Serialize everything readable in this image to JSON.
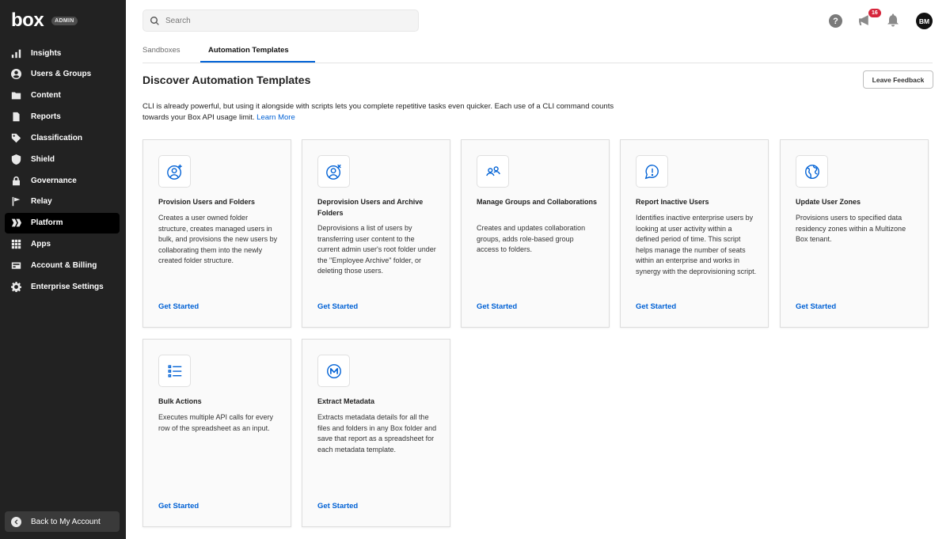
{
  "brand": {
    "logo": "box",
    "badge": "ADMIN"
  },
  "sidebar": {
    "items": [
      {
        "label": "Insights",
        "icon": "bar-chart-icon"
      },
      {
        "label": "Users & Groups",
        "icon": "user-circle-icon"
      },
      {
        "label": "Content",
        "icon": "folder-icon"
      },
      {
        "label": "Reports",
        "icon": "report-icon"
      },
      {
        "label": "Classification",
        "icon": "tag-icon"
      },
      {
        "label": "Shield",
        "icon": "shield-icon"
      },
      {
        "label": "Governance",
        "icon": "lock-icon"
      },
      {
        "label": "Relay",
        "icon": "relay-icon"
      },
      {
        "label": "Platform",
        "icon": "platform-icon"
      },
      {
        "label": "Apps",
        "icon": "apps-grid-icon"
      },
      {
        "label": "Account & Billing",
        "icon": "billing-icon"
      },
      {
        "label": "Enterprise Settings",
        "icon": "gear-icon"
      }
    ],
    "active": "Platform",
    "back_label": "Back to My Account"
  },
  "header": {
    "search_placeholder": "Search",
    "help": "?",
    "notification_count": "16",
    "avatar_initials": "BM"
  },
  "tabs": [
    {
      "label": "Sandboxes"
    },
    {
      "label": "Automation Templates"
    }
  ],
  "active_tab": "Automation Templates",
  "page": {
    "title": "Discover Automation Templates",
    "feedback_button": "Leave Feedback",
    "intro": "CLI is already powerful, but using it alongside with scripts lets you complete repetitive tasks even quicker. Each use of a CLI command counts towards your Box API usage limit.",
    "learn_more": "Learn More"
  },
  "accent_color": "#0061d5",
  "cards": [
    {
      "icon": "user-add-icon",
      "title": "Provision Users and Folders",
      "description": "Creates a user owned folder structure, creates managed users in bulk, and provisions the new users by collaborating them into the newly created folder structure.",
      "link": "Get Started"
    },
    {
      "icon": "user-remove-icon",
      "title": "Deprovision Users and Archive Folders",
      "description": "Deprovisions a list of users by transferring user content to the current admin user's root folder under the \"Employee Archive\" folder, or deleting those users.",
      "link": "Get Started"
    },
    {
      "icon": "group-icon",
      "title": "Manage Groups and Collaborations",
      "description": "Creates and updates collaboration groups, adds role-based group access to folders.",
      "link": "Get Started"
    },
    {
      "icon": "alert-bubble-icon",
      "title": "Report Inactive Users",
      "description": "Identifies inactive enterprise users by looking at user activity within a defined period of time. This script helps manage the number of seats within an enterprise and works in synergy with the deprovisioning script.",
      "link": "Get Started"
    },
    {
      "icon": "globe-icon",
      "title": "Update User Zones",
      "description": "Provisions users to specified data residency zones within a Multizone Box tenant.",
      "link": "Get Started"
    },
    {
      "icon": "list-icon",
      "title": "Bulk Actions",
      "description": "Executes multiple API calls for every row of the spreadsheet as an input.",
      "link": "Get Started"
    },
    {
      "icon": "metadata-icon",
      "title": "Extract Metadata",
      "description": "Extracts metadata details for all the files and folders in any Box folder and save that report as a spreadsheet for each metadata template.",
      "link": "Get Started"
    }
  ]
}
